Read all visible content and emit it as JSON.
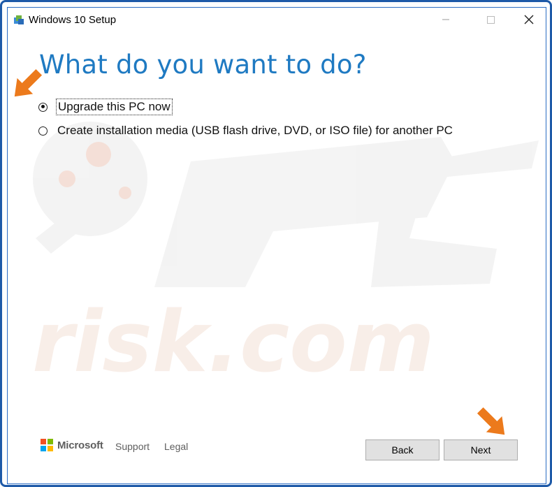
{
  "window": {
    "title": "Windows 10 Setup"
  },
  "page": {
    "heading": "What do you want to do?"
  },
  "options": [
    {
      "label": "Upgrade this PC now",
      "selected": true
    },
    {
      "label": "Create installation media (USB flash drive, DVD, or ISO file) for another PC",
      "selected": false
    }
  ],
  "footer": {
    "brand": "Microsoft",
    "links": [
      "Support",
      "Legal"
    ],
    "buttons": {
      "back": "Back",
      "next": "Next"
    }
  },
  "colors": {
    "heading": "#1f7ac2",
    "accent_arrow": "#ec7a1c",
    "frame_border": "#1e5aa8",
    "ms_red": "#f25022",
    "ms_green": "#7fba00",
    "ms_blue": "#00a4ef",
    "ms_yellow": "#ffb900"
  },
  "watermark": {
    "text": "risk.com",
    "brand": "PC"
  }
}
